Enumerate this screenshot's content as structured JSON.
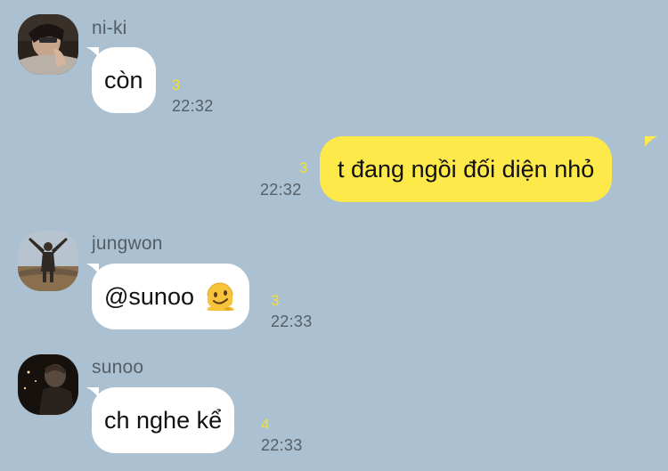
{
  "messages": [
    {
      "sender": "ni-ki",
      "text": "còn",
      "count": "3",
      "time": "22:32",
      "avatar_icon": "avatar-photo"
    },
    {
      "sender": "",
      "text": "t đang ngồi đối diện nhỏ",
      "count": "3",
      "time": "22:32"
    },
    {
      "sender": "jungwon",
      "text": "@sunoo",
      "emoji": "melting-face-emoji",
      "count": "3",
      "time": "22:33",
      "avatar_icon": "avatar-photo"
    },
    {
      "sender": "sunoo",
      "text": "ch nghe kể",
      "count": "4",
      "time": "22:33",
      "avatar_icon": "avatar-photo"
    }
  ],
  "colors": {
    "background": "#abc1d1",
    "incoming_bubble": "#ffffff",
    "outgoing_bubble": "#fee94a",
    "unread_count": "#f5e02a",
    "meta_text": "#555e66"
  }
}
